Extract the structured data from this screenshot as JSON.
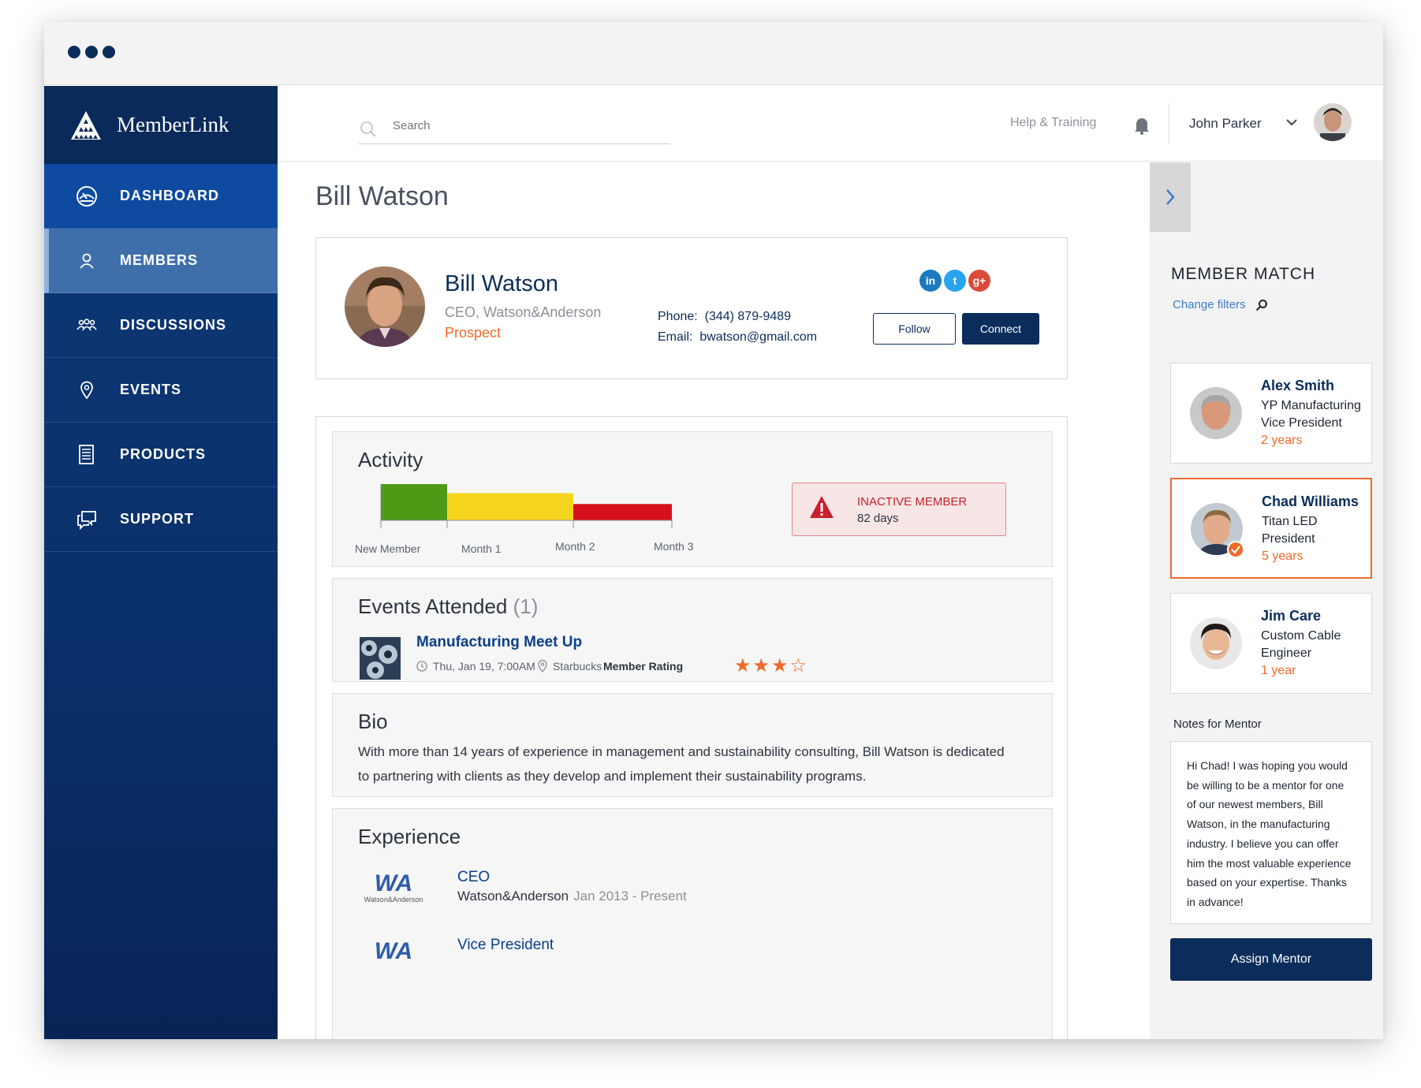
{
  "app": {
    "brand": "MemberLink"
  },
  "nav": {
    "items": [
      {
        "label": "DASHBOARD",
        "icon": "dashboard-icon"
      },
      {
        "label": "MEMBERS",
        "icon": "user-icon"
      },
      {
        "label": "DISCUSSIONS",
        "icon": "group-icon"
      },
      {
        "label": "EVENTS",
        "icon": "location-pin-icon"
      },
      {
        "label": "PRODUCTS",
        "icon": "document-icon"
      },
      {
        "label": "SUPPORT",
        "icon": "chat-icon"
      }
    ],
    "active": "MEMBERS"
  },
  "topbar": {
    "search_placeholder": "Search",
    "help": "Help & Training",
    "user_name": "John Parker"
  },
  "page": {
    "title": "Bill Watson"
  },
  "profile": {
    "name": "Bill Watson",
    "role": "CEO, Watson&Anderson",
    "status": "Prospect",
    "phone_label": "Phone:",
    "phone": "(344) 879-9489",
    "email_label": "Email:",
    "email": "bwatson@gmail.com",
    "follow": "Follow",
    "connect": "Connect",
    "social": [
      "in",
      "t",
      "g+"
    ]
  },
  "activity": {
    "title": "Activity",
    "labels": [
      "New Member",
      "Month 1",
      "Month 2",
      "Month 3"
    ],
    "segments": [
      {
        "color": "#4e9a17",
        "level": 1.0
      },
      {
        "color": "#f6d51f",
        "level": 0.75
      },
      {
        "color": "#d6111d",
        "level": 0.45
      }
    ],
    "alert_title": "INACTIVE MEMBER",
    "alert_days": "82 days"
  },
  "events": {
    "title": "Events Attended",
    "count": "(1)",
    "items": [
      {
        "title": "Manufacturing Meet Up",
        "date": "Thu, Jan 19, 7:00AM",
        "location": "Starbucks",
        "rating_label": "Member Rating",
        "rating": 3,
        "rating_max": 4
      }
    ]
  },
  "bio": {
    "title": "Bio",
    "text": "With more than 14 years of experience in management and sustainability consulting,  Bill Watson is dedicated to partnering with clients as they develop and implement their sustainability programs."
  },
  "experience": {
    "title": "Experience",
    "items": [
      {
        "logo": "WA",
        "logo_sub": "Watson&Anderson",
        "title": "CEO",
        "company": "Watson&Anderson",
        "dates": "Jan 2013 - Present"
      },
      {
        "logo": "WA",
        "title": "Vice President"
      }
    ]
  },
  "member_match": {
    "title": "MEMBER MATCH",
    "change_filters": "Change filters",
    "matches": [
      {
        "name": "Alex Smith",
        "company": "YP Manufacturing",
        "role": "Vice President",
        "years": "2 years",
        "selected": false
      },
      {
        "name": "Chad Williams",
        "company": "Titan LED",
        "role": "President",
        "years": "5 years",
        "selected": true
      },
      {
        "name": "Jim Care",
        "company": "Custom Cable",
        "role": "Engineer",
        "years": "1 year",
        "selected": false
      }
    ],
    "notes_label": "Notes for Mentor",
    "notes": "Hi Chad!  I was hoping you would be willing to be a mentor for one of our newest members, Bill Watson, in the manufacturing industry. I believe you can offer him the most valuable experience based on your expertise. Thanks in advance!",
    "assign": "Assign Mentor"
  },
  "colors": {
    "navy": "#0b2d5b",
    "accent": "#f06a2a",
    "link": "#3b7bc8"
  }
}
